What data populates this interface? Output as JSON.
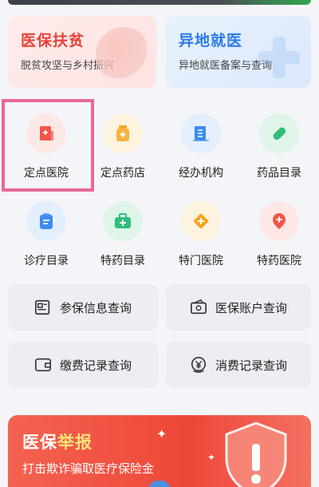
{
  "banners": {
    "left": {
      "title": "医保扶贫",
      "subtitle": "脱贫攻坚与乡村振兴"
    },
    "right": {
      "title": "异地就医",
      "subtitle": "异地就医备案与查询"
    }
  },
  "services": [
    {
      "label": "定点医院",
      "icon": "hospital-icon",
      "color": "#f0564a",
      "bg": "#fde8e6"
    },
    {
      "label": "定点药店",
      "icon": "pharmacy-icon",
      "color": "#f4a623",
      "bg": "#fef3de"
    },
    {
      "label": "经办机构",
      "icon": "building-icon",
      "color": "#3d8bef",
      "bg": "#e3effd"
    },
    {
      "label": "药品目录",
      "icon": "pill-icon",
      "color": "#2fbf7a",
      "bg": "#dff5ea"
    },
    {
      "label": "诊疗目录",
      "icon": "clipboard-icon",
      "color": "#3d8bef",
      "bg": "#e3effd"
    },
    {
      "label": "特药目录",
      "icon": "medkit-icon",
      "color": "#2fbf7a",
      "bg": "#dff5ea"
    },
    {
      "label": "特门医院",
      "icon": "diamond-plus-icon",
      "color": "#f4a623",
      "bg": "#fef3de"
    },
    {
      "label": "特药医院",
      "icon": "location-plus-icon",
      "color": "#f0564a",
      "bg": "#fde8e6"
    }
  ],
  "queries": [
    {
      "label": "参保信息查询",
      "icon": "id-card-icon"
    },
    {
      "label": "医保账户查询",
      "icon": "account-icon"
    },
    {
      "label": "缴费记录查询",
      "icon": "wallet-icon"
    },
    {
      "label": "消费记录查询",
      "icon": "yuan-icon"
    }
  ],
  "promo": {
    "title_main": "医保",
    "title_accent": "举报",
    "subtitle": "打击欺诈骗取医疗保险金"
  }
}
